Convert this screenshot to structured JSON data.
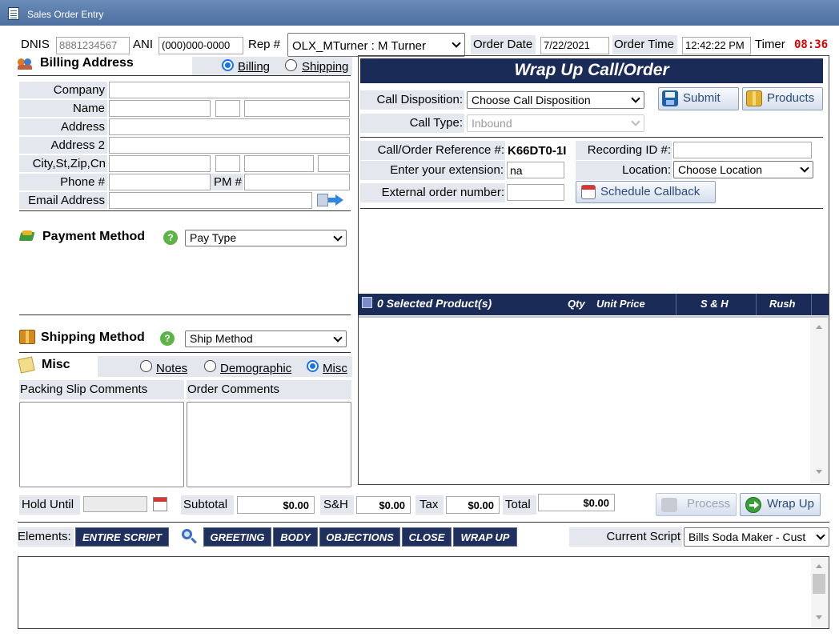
{
  "window": {
    "title": "Sales Order Entry"
  },
  "header": {
    "dnis_label": "DNIS",
    "dnis_value": "8881234567",
    "ani_label": "ANI",
    "ani_value": "(000)000-0000",
    "rep_label": "Rep #",
    "rep_value": "OLX_MTurner : M Turner",
    "order_date_label": "Order Date",
    "order_date_value": "7/22/2021",
    "order_time_label": "Order Time",
    "order_time_value": "12:42:22 PM",
    "timer_label": "Timer",
    "timer_value": "08:36"
  },
  "billing": {
    "title": "Billing Address",
    "radio_billing": "Billing",
    "radio_shipping": "Shipping",
    "company_label": "Company",
    "name_label": "Name",
    "address_label": "Address",
    "address2_label": "Address 2",
    "citystzip_label": "City,St,Zip,Cn",
    "phone_label": "Phone #",
    "pm_label": "PM #",
    "email_label": "Email Address"
  },
  "payment": {
    "title": "Payment Method",
    "select_value": "Pay Type"
  },
  "shipping": {
    "title": "Shipping Method",
    "select_value": "Ship Method"
  },
  "misc": {
    "title": "Misc",
    "radio_notes": "Notes",
    "radio_demographic": "Demographic",
    "radio_misc": "Misc",
    "packing_label": "Packing Slip Comments",
    "order_comments_label": "Order Comments"
  },
  "wrapup": {
    "title": "Wrap Up Call/Order",
    "call_disposition_label": "Call Disposition:",
    "call_disposition_value": "Choose Call Disposition",
    "call_type_label": "Call Type:",
    "call_type_value": "Inbound",
    "submit_label": "Submit",
    "products_label": "Products",
    "reference_label": "Call/Order Reference #:",
    "reference_value": "K66DT0-1I",
    "recording_label": "Recording ID #:",
    "extension_label": "Enter your extension:",
    "extension_value": "na",
    "location_label": "Location:",
    "location_value": "Choose Location",
    "external_label": "External order number:",
    "schedule_label": "Schedule Callback"
  },
  "products": {
    "header_count": "0 Selected Product(s)",
    "col_qty": "Qty",
    "col_unit_price": "Unit Price",
    "col_sh": "S & H",
    "col_rush": "Rush"
  },
  "totals": {
    "hold_until_label": "Hold Until",
    "subtotal_label": "Subtotal",
    "subtotal_value": "$0.00",
    "sh_label": "S&H",
    "sh_value": "$0.00",
    "tax_label": "Tax",
    "tax_value": "$0.00",
    "total_label": "Total",
    "total_value": "$0.00",
    "process_label": "Process",
    "wrapup_label": "Wrap Up"
  },
  "script": {
    "elements_label": "Elements:",
    "tabs": [
      "ENTIRE SCRIPT",
      "GREETING",
      "BODY",
      "OBJECTIONS",
      "CLOSE",
      "WRAP UP"
    ],
    "current_label": "Current Script",
    "current_value": "Bills Soda Maker - Cust"
  },
  "colors": {
    "navy": "#1b2b58",
    "timer_red": "#e00000",
    "button_text": "#2a4b7c"
  }
}
